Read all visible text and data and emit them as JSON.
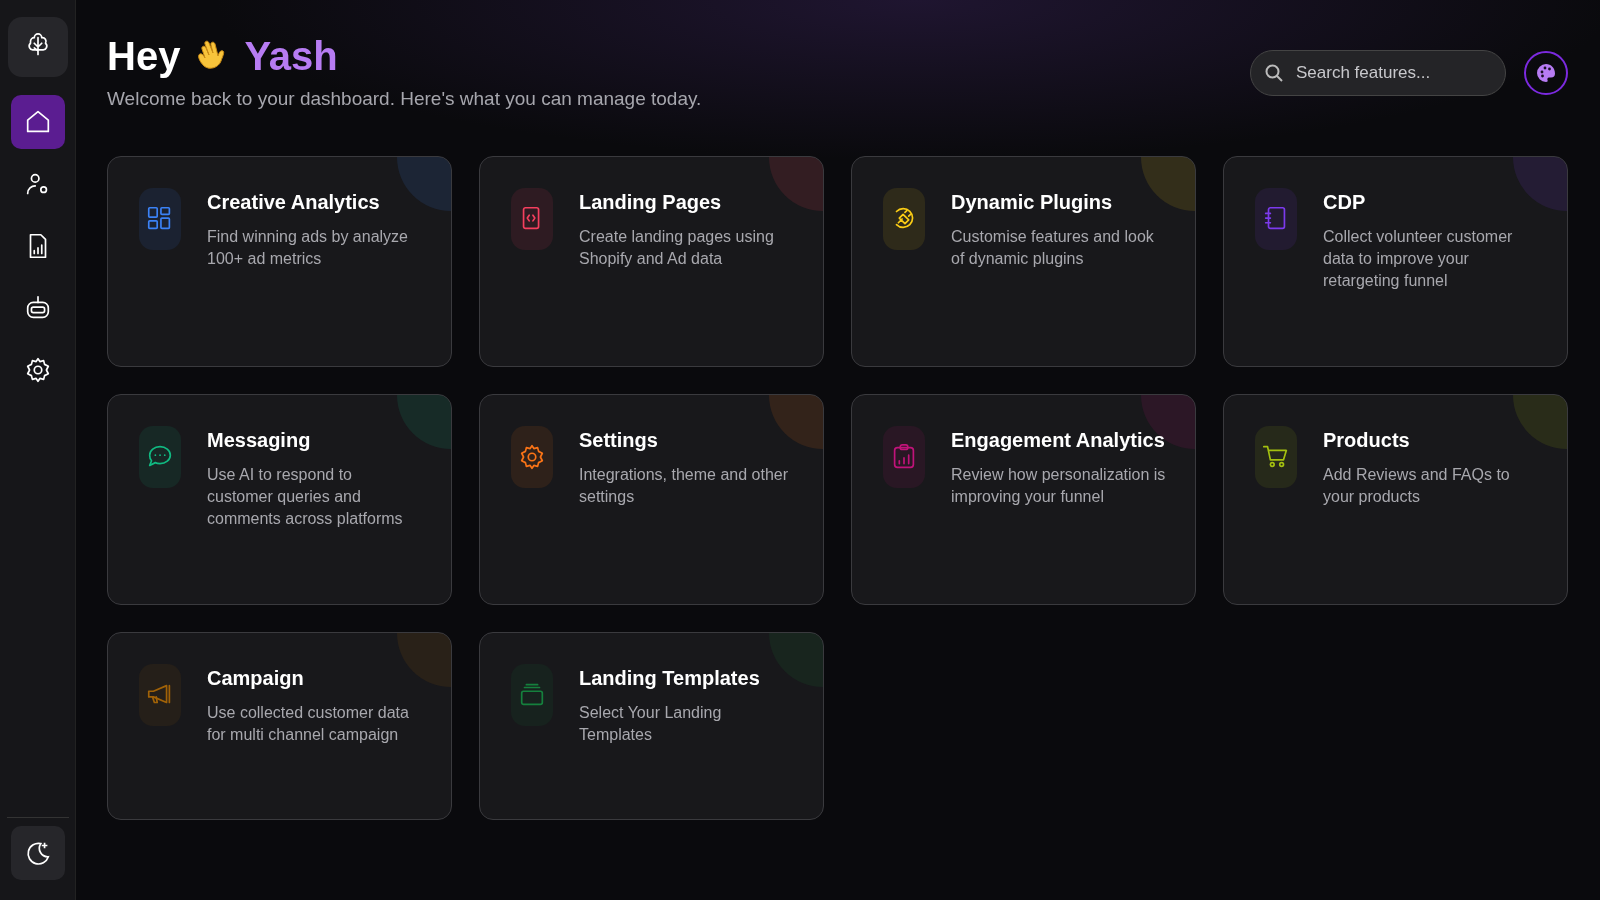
{
  "sidebar": {
    "items": [
      {
        "selected": false
      },
      {
        "selected": true
      },
      {
        "selected": false
      },
      {
        "selected": false
      },
      {
        "selected": false
      },
      {
        "selected": false
      }
    ]
  },
  "header": {
    "greeting": "Hey",
    "name": "Yash",
    "subtitle": "Welcome back to your dashboard. Here's what you can manage today."
  },
  "search": {
    "placeholder": "Search features..."
  },
  "cards": [
    {
      "title": "Creative Analytics",
      "description": "Find winning ads by analyze 100+ ad metrics",
      "color": "#3b82f6"
    },
    {
      "title": "Landing Pages",
      "description": "Create landing pages using Shopify and Ad data",
      "color": "#f43f5e"
    },
    {
      "title": "Dynamic Plugins",
      "description": "Customise features and look of dynamic plugins",
      "color": "#facc15"
    },
    {
      "title": "CDP",
      "description": "Collect volunteer customer data to improve your retargeting funnel",
      "color": "#7c3aed"
    },
    {
      "title": "Messaging",
      "description": "Use AI to respond to customer queries and comments across platforms",
      "color": "#10b981"
    },
    {
      "title": "Settings",
      "description": "Integrations, theme and other settings",
      "color": "#f97316"
    },
    {
      "title": "Engagement Analytics",
      "description": "Review how personalization is improving your funnel",
      "color": "#c0137a"
    },
    {
      "title": "Products",
      "description": "Add Reviews and FAQs to your products",
      "color": "#a3c010"
    },
    {
      "title": "Campaign",
      "description": "Use collected customer data for multi channel campaign",
      "color": "#a16207"
    },
    {
      "title": "Landing Templates",
      "description": "Select Your Landing Templates",
      "color": "#15803d"
    }
  ]
}
